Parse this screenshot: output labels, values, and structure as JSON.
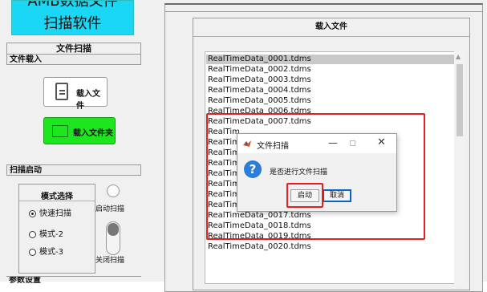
{
  "app": {
    "title_line1": "AMB数据文件",
    "title_line2": "扫描软件"
  },
  "left": {
    "scan_section_caption": "文件扫描",
    "file_load_header": "文件载入",
    "load_file_label": "载入文件",
    "load_folder_label": "载入文件夹",
    "scan_start_header": "扫描启动",
    "mode_select_title": "模式选择",
    "modes": [
      {
        "label": "快速扫描",
        "selected": true
      },
      {
        "label": "模式-2",
        "selected": false
      },
      {
        "label": "模式-3",
        "selected": false
      }
    ],
    "scan_on_label": "启动扫描",
    "scan_off_label": "关闭扫描",
    "params_header": "参数设置"
  },
  "load_panel": {
    "caption": "载入文件",
    "files": [
      "RealTimeData_0001.tdms",
      "RealTimeData_0002.tdms",
      "RealTimeData_0003.tdms",
      "RealTimeData_0004.tdms",
      "RealTimeData_0005.tdms",
      "RealTimeData_0006.tdms",
      "RealTimeData_0007.tdms",
      "RealTim",
      "RealTim",
      "RealTim",
      "RealTim",
      "RealTim",
      "RealTimeData_0014.tdms",
      "RealTimeData_0015.tdms",
      "RealTimeData_0016.tdms",
      "RealTimeData_0017.tdms",
      "RealTimeData_0018.tdms",
      "RealTimeData_0019.tdms",
      "RealTimeData_0020.tdms"
    ],
    "selected_index": 0
  },
  "dialog": {
    "title": "文件扫描",
    "minimize_glyph": "—",
    "close_glyph": "✕",
    "question_glyph": "?",
    "message": "是否进行文件扫描",
    "ok_label": "启动",
    "cancel_label": "取消"
  },
  "colors": {
    "title_bg": "#1ad8f5",
    "folder_btn_bg": "#1ee61e",
    "highlight": "#e81e1e",
    "question_icon": "#2a7ed8"
  },
  "icons": [
    "document-icon",
    "folder-icon",
    "matlab-app-icon",
    "question-icon"
  ]
}
